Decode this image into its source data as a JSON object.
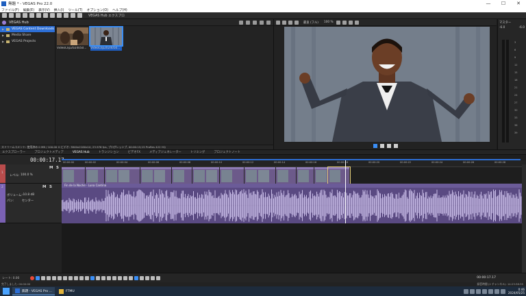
{
  "window": {
    "title": "無題 * - VEGAS Pro 22.0",
    "buttons": [
      "—",
      "☐",
      "✕"
    ]
  },
  "menu": [
    "ファイル(F)",
    "編集(E)",
    "表示(V)",
    "挿入(I)",
    "ツール(T)",
    "オプション(O)",
    "ヘルプ(H)"
  ],
  "toolbar": {
    "hub_label": "VEGAS Hub エクスプロ"
  },
  "hub": {
    "title": "VEGAS Hub",
    "tree": [
      {
        "label": "VEGAS Content Downloads",
        "selected": true
      },
      {
        "label": "Media Share",
        "selected": false
      },
      {
        "label": "VEGAS Projects",
        "selected": false
      }
    ],
    "thumbs": [
      {
        "caption": "VideoClip2024050...",
        "selected": false
      },
      {
        "caption": "VideoClip2024050...",
        "selected": true
      }
    ],
    "status": "ストリームコメント: 使用済み 0 MB / 100.00 G   ビデオ: 3840x2160x10, 23.976 fps, プログレッシブ, 00:00:15;15 ProRes 422 HQ"
  },
  "preview": {
    "quality": "最良 (フル)",
    "zoom": "100 %"
  },
  "meters": {
    "label": "マスター",
    "top_values": [
      "-6.0",
      "-6.0"
    ],
    "scale": [
      "3",
      "6",
      "9",
      "12",
      "15",
      "18",
      "21",
      "24",
      "27",
      "30",
      "33",
      "36",
      "39",
      "42"
    ]
  },
  "dock_tabs": [
    "エクスプローラー",
    "プロジェクトメディア",
    "VEGAS Hub",
    "トランジション",
    "ビデオFX",
    "メディアジェネレーター",
    "トリミング",
    "プロジェクトノート"
  ],
  "timeline": {
    "timecode": "00:00:17.17",
    "ruler_ticks": [
      "00:00:00",
      "00:00:02",
      "00:00:04",
      "00:00:06",
      "00:00:08",
      "00:00:10",
      "00:00:12",
      "00:00:14",
      "00:00:16",
      "00:00:18",
      "00:00:20",
      "00:00:22",
      "00:00:24",
      "00:00:26",
      "00:00:28"
    ],
    "video_track": {
      "number": "1",
      "level_label": "レベル:",
      "level_value": "100.0 %"
    },
    "audio_track": {
      "number": "2",
      "vol_label": "ボリューム:",
      "vol_value": "-10.8 dB",
      "pan_label": "パン:",
      "pan_value": "センター",
      "clip_name": "Fin de la Noche - Luna Cantina"
    }
  },
  "transport": {
    "rate": "レート: 0.00",
    "timecode": "00:00:17.17"
  },
  "status": {
    "left": "完了しました: 00:00:00",
    "right": "録音時間 (2 チャンネル): 14:23:38:35"
  },
  "taskbar": {
    "tasks": [
      {
        "label": "無題 - VEGAS Pro ...",
        "active": true
      },
      {
        "label": "FTMU",
        "active": false
      }
    ],
    "time": "0:46",
    "date": "2024/05/25"
  },
  "colors": {
    "accent": "#2d6fd6",
    "clip": "#6c5a8a",
    "audio": "#5a4a82"
  }
}
